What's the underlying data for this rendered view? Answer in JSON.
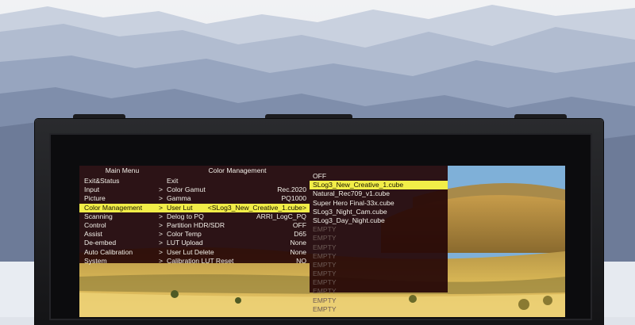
{
  "main_menu": {
    "title": "Main Menu",
    "items": [
      {
        "label": "Exit&Status",
        "arrow": "",
        "selected": false
      },
      {
        "label": "Input",
        "arrow": ">",
        "selected": false
      },
      {
        "label": "Picture",
        "arrow": ">",
        "selected": false
      },
      {
        "label": "Color Management",
        "arrow": ">",
        "selected": true
      },
      {
        "label": "Scanning",
        "arrow": ">",
        "selected": false
      },
      {
        "label": "Control",
        "arrow": ">",
        "selected": false
      },
      {
        "label": "Assist",
        "arrow": ">",
        "selected": false
      },
      {
        "label": "De-embed",
        "arrow": ">",
        "selected": false
      },
      {
        "label": "Auto Calibration",
        "arrow": ">",
        "selected": false
      },
      {
        "label": "System",
        "arrow": ">",
        "selected": false
      }
    ]
  },
  "color_management": {
    "title": "Color Management",
    "items": [
      {
        "label": "Exit",
        "value": "",
        "selected": false
      },
      {
        "label": "Color Gamut",
        "value": "Rec.2020",
        "selected": false
      },
      {
        "label": "Gamma",
        "value": "PQ1000",
        "selected": false
      },
      {
        "label": "User Lut",
        "value": "<SLog3_New_Creative_1.cube>",
        "selected": true
      },
      {
        "label": "Delog to PQ",
        "value": "ARRI_LogC_PQ",
        "selected": false
      },
      {
        "label": "Partition HDR/SDR",
        "value": "OFF",
        "selected": false
      },
      {
        "label": "Color Temp",
        "value": "D65",
        "selected": false
      },
      {
        "label": "LUT Upload",
        "value": "None",
        "selected": false
      },
      {
        "label": "User Lut Delete",
        "value": "None",
        "selected": false
      },
      {
        "label": "Calibration LUT Reset",
        "value": "NO",
        "selected": false
      }
    ]
  },
  "lut_list": {
    "items": [
      {
        "label": "OFF",
        "selected": false,
        "empty": false
      },
      {
        "label": "SLog3_New_Creative_1.cube",
        "selected": true,
        "empty": false
      },
      {
        "label": "Natural_Rec709_v1.cube",
        "selected": false,
        "empty": false
      },
      {
        "label": "Super Hero Final-33x.cube",
        "selected": false,
        "empty": false
      },
      {
        "label": "SLog3_Night_Cam.cube",
        "selected": false,
        "empty": false
      },
      {
        "label": "SLog3_Day_Night.cube",
        "selected": false,
        "empty": false
      },
      {
        "label": "EMPTY",
        "selected": false,
        "empty": true
      },
      {
        "label": "EMPTY",
        "selected": false,
        "empty": true
      },
      {
        "label": "EMPTY",
        "selected": false,
        "empty": true
      },
      {
        "label": "EMPTY",
        "selected": false,
        "empty": true
      },
      {
        "label": "EMPTY",
        "selected": false,
        "empty": true
      },
      {
        "label": "EMPTY",
        "selected": false,
        "empty": true
      },
      {
        "label": "EMPTY",
        "selected": false,
        "empty": true
      },
      {
        "label": "EMPTY",
        "selected": false,
        "empty": true
      },
      {
        "label": "EMPTY",
        "selected": false,
        "empty": true
      },
      {
        "label": "EMPTY",
        "selected": false,
        "empty": true
      }
    ]
  },
  "colors": {
    "highlight": "#f2ee48",
    "osd_background": "#260606",
    "empty_text": "#6d5a55"
  }
}
